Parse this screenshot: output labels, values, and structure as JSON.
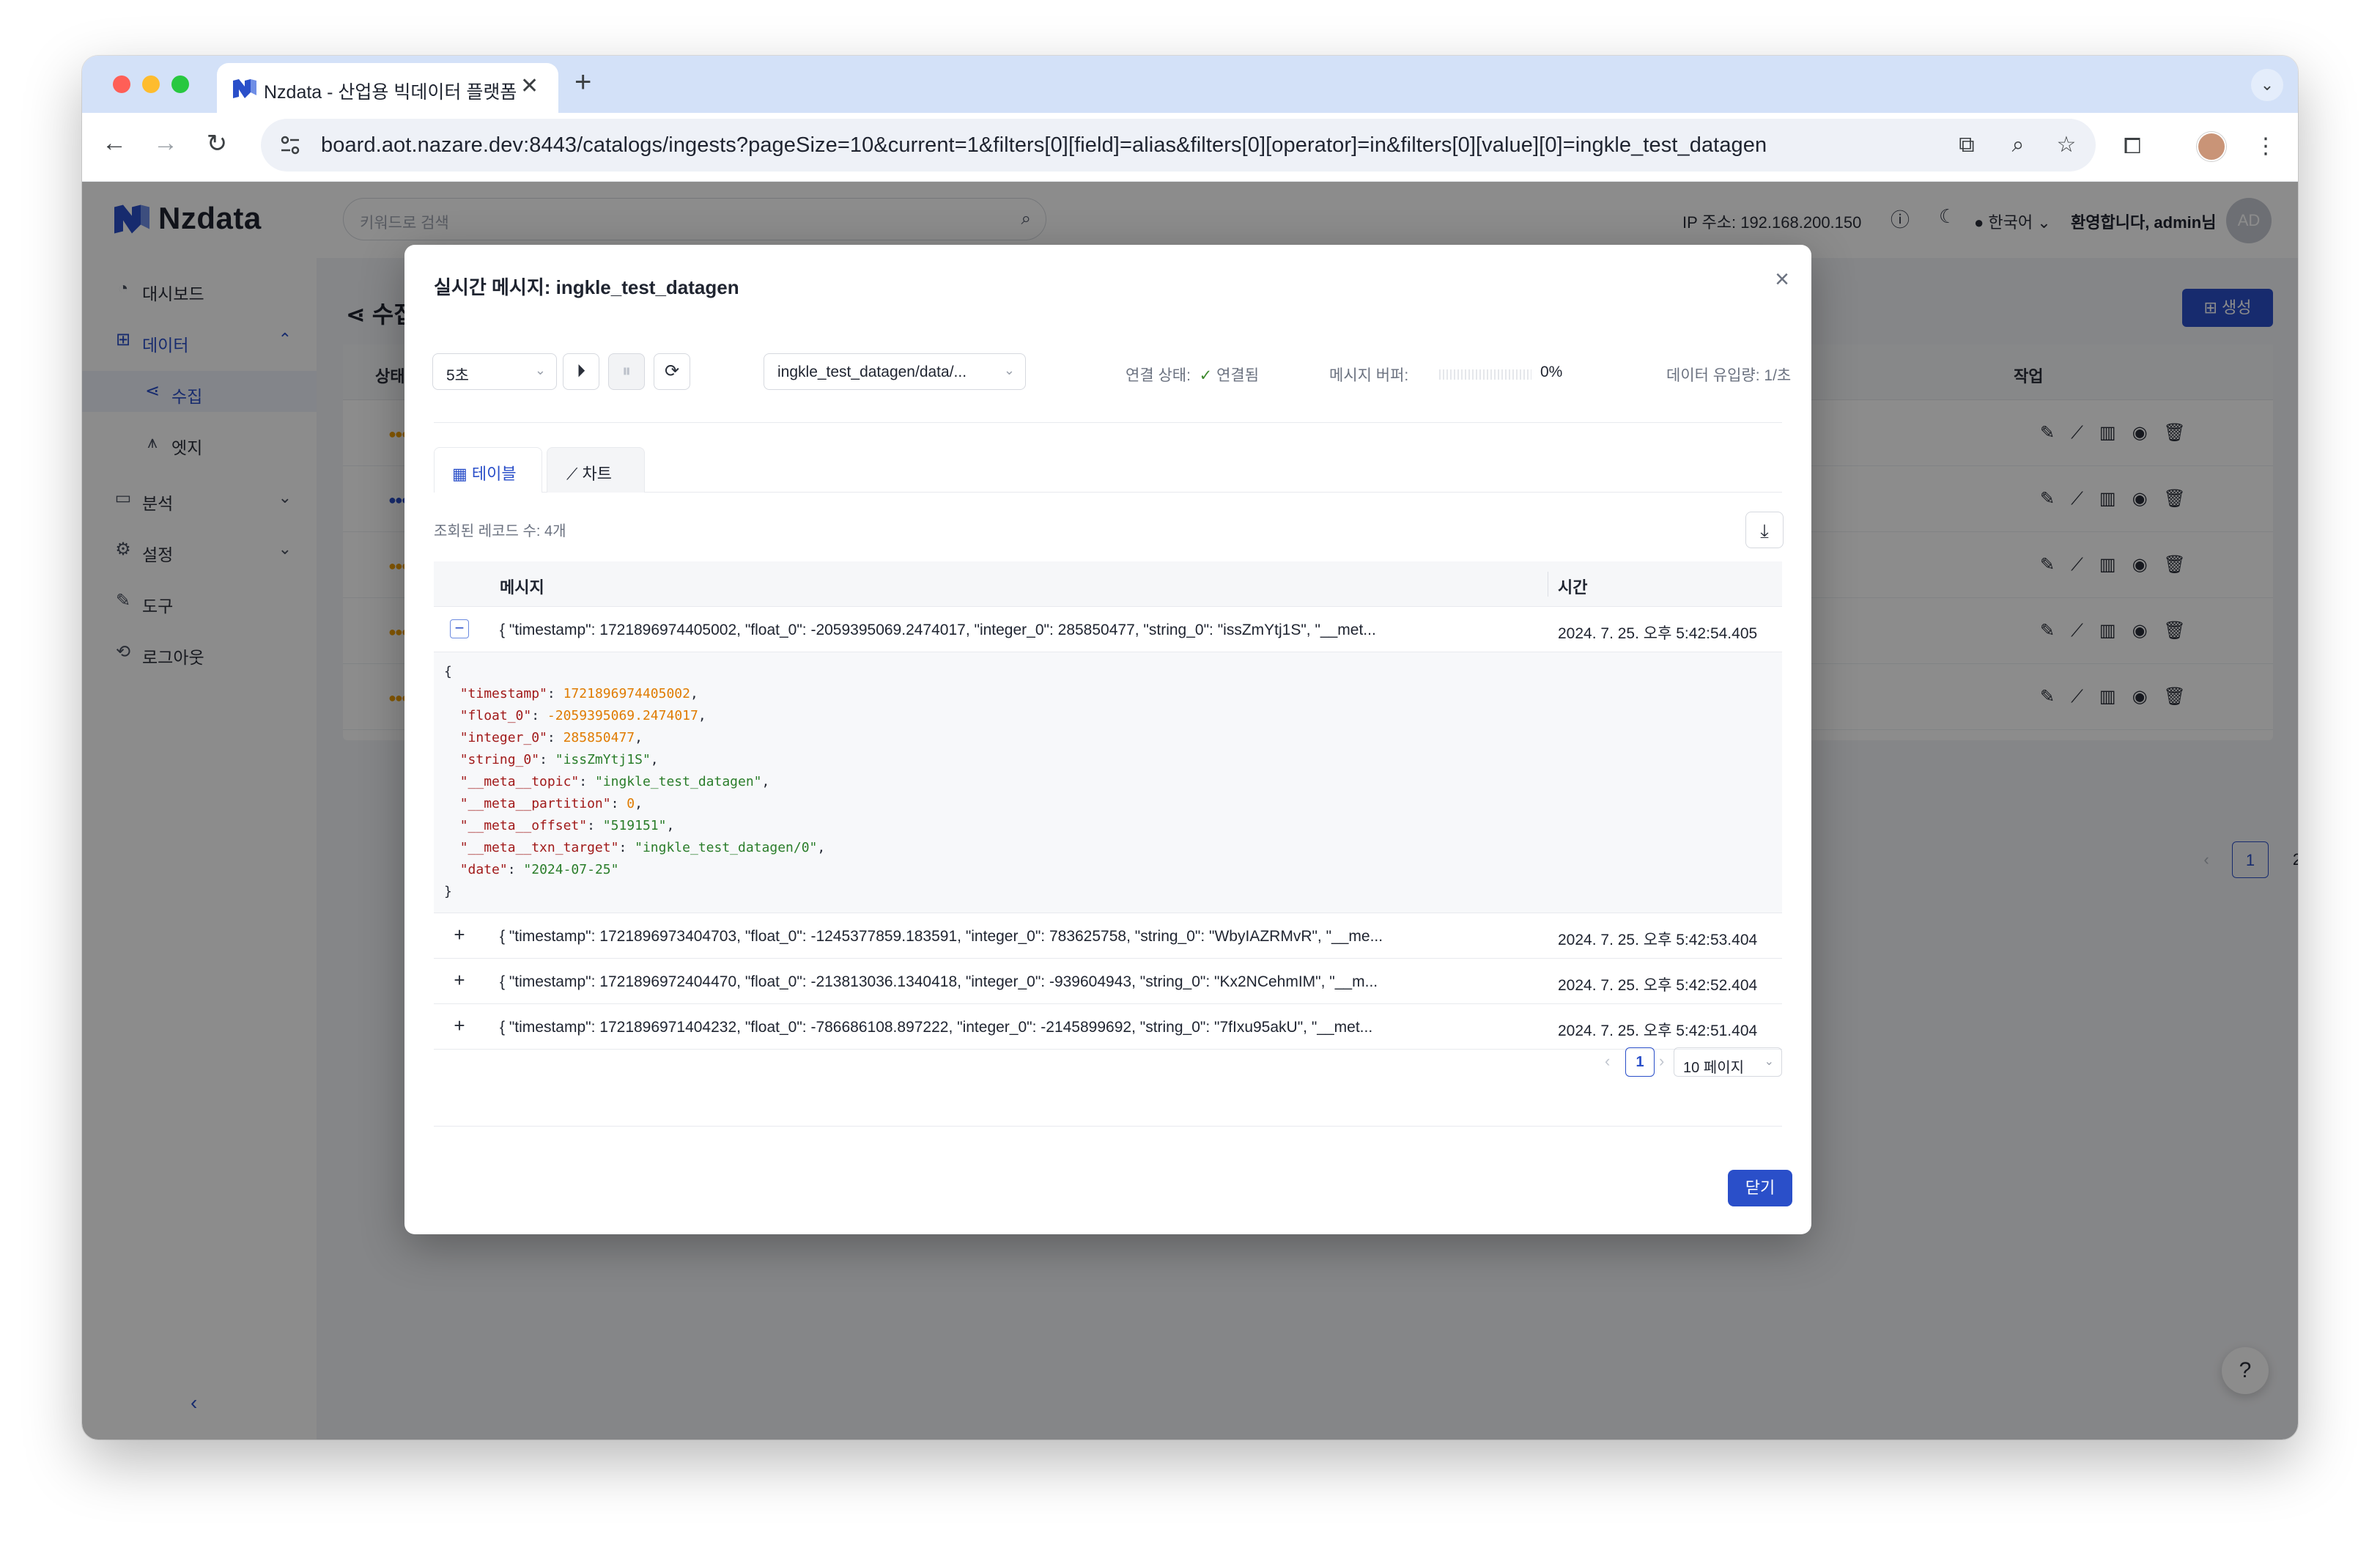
{
  "browser": {
    "tab_title": "Nzdata - 산업용 빅데이터 플랫폼",
    "tab_close": "✕",
    "new_tab": "+",
    "url": "board.aot.nazare.dev:8443/catalogs/ingests?pageSize=10&current=1&filters[0][field]=alias&filters[0][operator]=in&filters[0][value][0]=ingkle_test_datagen",
    "traffic_colors": {
      "close": "#ff5f57",
      "minimize": "#febc2e",
      "maximize": "#28c840"
    }
  },
  "app": {
    "brand": "Nzdata",
    "search_placeholder": "키워드로 검색",
    "ip_label": "IP 주소: 192.168.200.150",
    "language": "한국어",
    "welcome": "환영합니다, admin님",
    "avatar_initials": "AD",
    "accent_color": "#2a4fc9"
  },
  "sidebar": {
    "items": [
      {
        "label": "대시보드",
        "icon": "dashboard-icon"
      },
      {
        "label": "데이터",
        "icon": "data-icon"
      },
      {
        "label": "수집",
        "icon": "ingest-icon"
      },
      {
        "label": "엣지",
        "icon": "edge-icon"
      },
      {
        "label": "분석",
        "icon": "analysis-icon"
      },
      {
        "label": "설정",
        "icon": "settings-icon"
      },
      {
        "label": "도구",
        "icon": "tool-icon"
      },
      {
        "label": "로그아웃",
        "icon": "logout-icon"
      }
    ]
  },
  "page": {
    "title": "수집 목록",
    "create_label": "생성",
    "col_status": "상태",
    "col_actions": "작업",
    "pages": [
      "1",
      "2"
    ]
  },
  "modal": {
    "title": "실시간 메시지: ingkle_test_datagen",
    "interval": "5초",
    "topic": "ingkle_test_datagen/data/...",
    "connection_label": "연결 상태:",
    "connection_value": "연결됨",
    "buffer_label": "메시지 버퍼:",
    "buffer_value": "0%",
    "buffer_fraction": 0,
    "rate_label": "데이터 유입량: 1/초",
    "tabs": [
      {
        "label": "테이블",
        "icon": "table-icon"
      },
      {
        "label": "차트",
        "icon": "line-chart-icon"
      }
    ],
    "record_count": "조회된 레코드 수: 4개",
    "col_message": "메시지",
    "col_time": "시간",
    "rows": [
      {
        "message": "{ \"timestamp\": 1721896974405002, \"float_0\": -2059395069.2474017, \"integer_0\": 285850477, \"string_0\": \"issZmYtj1S\", \"__met...",
        "time": "2024. 7. 25. 오후 5:42:54.405",
        "toggle": "−"
      },
      {
        "message": "{ \"timestamp\": 1721896973404703, \"float_0\": -1245377859.183591, \"integer_0\": 783625758, \"string_0\": \"WbyIAZRMvR\", \"__me...",
        "time": "2024. 7. 25. 오후 5:42:53.404",
        "toggle": "+"
      },
      {
        "message": "{ \"timestamp\": 1721896972404470, \"float_0\": -213813036.1340418, \"integer_0\": -939604943, \"string_0\": \"Kx2NCehmIM\", \"__m...",
        "time": "2024. 7. 25. 오후 5:42:52.404",
        "toggle": "+"
      },
      {
        "message": "{ \"timestamp\": 1721896971404232, \"float_0\": -786686108.897222, \"integer_0\": -2145899692, \"string_0\": \"7fIxu95akU\", \"__met...",
        "time": "2024. 7. 25. 오후 5:42:51.404",
        "toggle": "+"
      }
    ],
    "json_lines": [
      {
        "k": "",
        "v": "",
        "t": "p",
        "pre": "{"
      },
      {
        "k": "\"timestamp\"",
        "v": "1721896974405002",
        "t": "n",
        "pre": "  "
      },
      {
        "k": "\"float_0\"",
        "v": "-2059395069.2474017",
        "t": "n",
        "pre": "  "
      },
      {
        "k": "\"integer_0\"",
        "v": "285850477",
        "t": "n",
        "pre": "  "
      },
      {
        "k": "\"string_0\"",
        "v": "\"issZmYtj1S\"",
        "t": "s",
        "pre": "  "
      },
      {
        "k": "\"__meta__topic\"",
        "v": "\"ingkle_test_datagen\"",
        "t": "s",
        "pre": "  "
      },
      {
        "k": "\"__meta__partition\"",
        "v": "0",
        "t": "n",
        "pre": "  "
      },
      {
        "k": "\"__meta__offset\"",
        "v": "\"519151\"",
        "t": "s",
        "pre": "  "
      },
      {
        "k": "\"__meta__txn_target\"",
        "v": "\"ingkle_test_datagen/0\"",
        "t": "s",
        "pre": "  "
      },
      {
        "k": "\"date\"",
        "v": "\"2024-07-25\"",
        "t": "s",
        "pre": "  ",
        "last": true
      },
      {
        "k": "",
        "v": "",
        "t": "p",
        "pre": "}"
      }
    ],
    "pager_page": "1",
    "page_size": "10 페이지",
    "close_label": "닫기"
  }
}
